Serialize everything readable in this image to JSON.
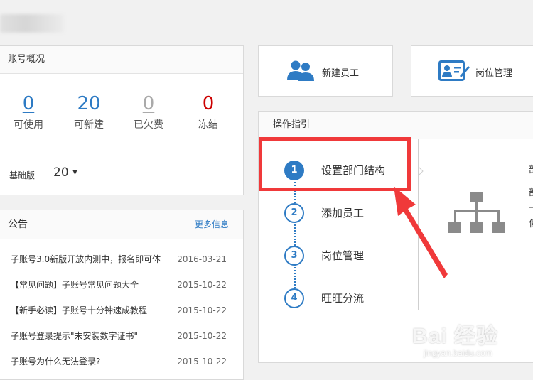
{
  "top_blur": "",
  "account": {
    "title": "账号概况",
    "stats": [
      {
        "value": "0",
        "label": "可使用",
        "color": "#2e7bc4"
      },
      {
        "value": "20",
        "label": "可新建",
        "color": "#2e7bc4"
      },
      {
        "value": "0",
        "label": "已欠费",
        "color": "#aaaaaa"
      },
      {
        "value": "0",
        "label": "冻结",
        "color": "#cc0000"
      }
    ],
    "edition_label": "基础版",
    "edition_value": "20"
  },
  "notice": {
    "title": "公告",
    "more": "更多信息",
    "items": [
      {
        "text": "子账号3.0新版开放内测中，报名即可体",
        "date": "2016-03-21"
      },
      {
        "text": "【常见问题】子账号常见问题大全",
        "date": "2015-10-22"
      },
      {
        "text": "【新手必读】子账号十分钟速成教程",
        "date": "2015-10-22"
      },
      {
        "text": "子账号登录提示\"未安装数字证书\"",
        "date": "2015-10-22"
      },
      {
        "text": "子账号为什么无法登录?",
        "date": "2015-10-22"
      }
    ]
  },
  "actions": {
    "new_employee": "新建员工",
    "position_mgmt": "岗位管理"
  },
  "guide": {
    "title": "操作指引",
    "steps": [
      {
        "num": "1",
        "label": "设置部门结构"
      },
      {
        "num": "2",
        "label": "添加员工"
      },
      {
        "num": "3",
        "label": "岗位管理"
      },
      {
        "num": "4",
        "label": "旺旺分流"
      }
    ],
    "side_text": [
      "部",
      "部",
      "一",
      "使"
    ]
  },
  "watermark": {
    "brand": "Bai 经验",
    "url": "jingyan.baidu.com"
  }
}
